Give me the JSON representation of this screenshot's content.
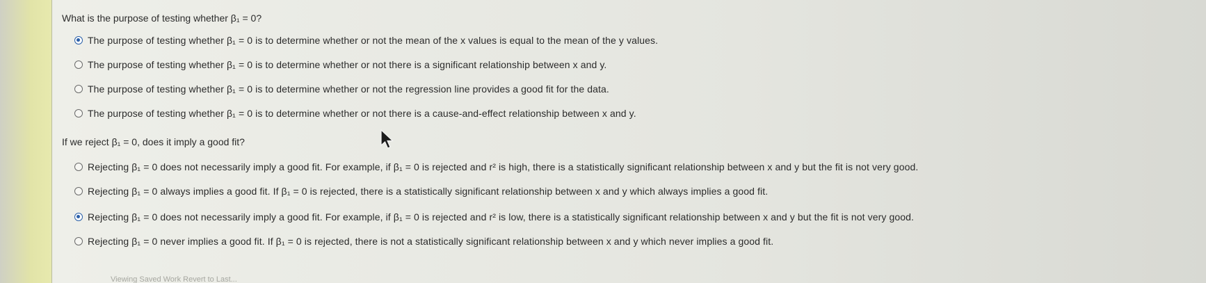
{
  "question1": {
    "prompt": "What is the purpose of testing whether β₁ = 0?",
    "options": [
      {
        "label": "The purpose of testing whether β₁ = 0 is to determine whether or not the mean of the x values is equal to the mean of the y values.",
        "selected": true
      },
      {
        "label": "The purpose of testing whether β₁ = 0 is to determine whether or not there is a significant relationship between x and y.",
        "selected": false
      },
      {
        "label": "The purpose of testing whether β₁ = 0 is to determine whether or not the regression line provides a good fit for the data.",
        "selected": false
      },
      {
        "label": "The purpose of testing whether β₁ = 0 is to determine whether or not there is a cause-and-effect relationship between x and y.",
        "selected": false
      }
    ]
  },
  "question2": {
    "prompt": "If we reject β₁ = 0, does it imply a good fit?",
    "options": [
      {
        "label": "Rejecting β₁ = 0 does not necessarily imply a good fit. For example, if β₁ = 0 is rejected and r² is high, there is a statistically significant relationship between x and y but the fit is not very good.",
        "selected": false
      },
      {
        "label": "Rejecting β₁ = 0 always implies a good fit. If β₁ = 0 is rejected, there is a statistically significant relationship between x and y which always implies a good fit.",
        "selected": false
      },
      {
        "label": "Rejecting β₁ = 0 does not necessarily imply a good fit. For example, if β₁ = 0 is rejected and r² is low, there is a statistically significant relationship between x and y but the fit is not very good.",
        "selected": true
      },
      {
        "label": "Rejecting β₁ = 0 never implies a good fit. If β₁ = 0 is rejected, there is not a statistically significant relationship between x and y which never implies a good fit.",
        "selected": false
      }
    ]
  },
  "footer_text": "Viewing Saved Work Revert to Last...",
  "colors": {
    "radio_selected": "#2a5fa8",
    "text": "#2b2b2b",
    "left_strip": "#e2e4a8"
  },
  "icons": {
    "cursor": "arrow-cursor-icon"
  }
}
